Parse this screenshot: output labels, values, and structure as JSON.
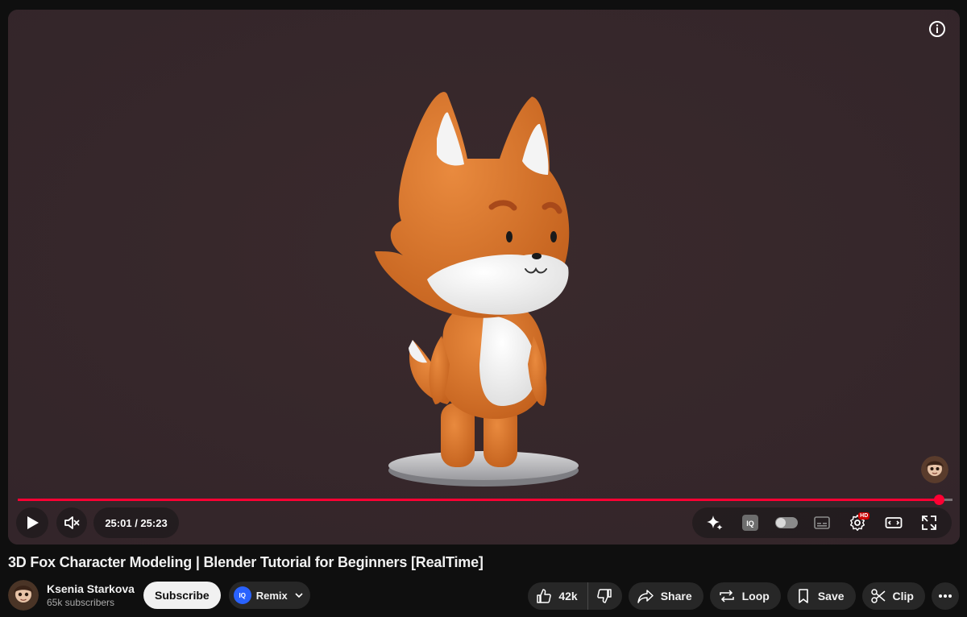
{
  "video": {
    "title": "3D Fox Character Modeling | Blender Tutorial for Beginners [RealTime]",
    "current_time": "25:01",
    "time_separator": " / ",
    "duration": "25:23",
    "progress_fraction": 0.985,
    "colors": {
      "background": "#362729",
      "progress": "#ff0033"
    }
  },
  "player_controls": {
    "play_icon": "play-icon",
    "mute_icon": "volume-muted-icon",
    "right_icons": [
      "sparkle-icon",
      "iq-icon",
      "autoplay-toggle",
      "subtitles-icon",
      "settings-icon",
      "theater-mode-icon",
      "fullscreen-icon"
    ],
    "settings_badge": "HD"
  },
  "channel": {
    "name": "Ksenia Starkova",
    "subscribers": "65k subscribers",
    "subscribe_label": "Subscribe",
    "remix_logo_text": "IQ",
    "remix_label": "Remix"
  },
  "actions": {
    "like_count": "42k",
    "share_label": "Share",
    "loop_label": "Loop",
    "save_label": "Save",
    "clip_label": "Clip"
  }
}
